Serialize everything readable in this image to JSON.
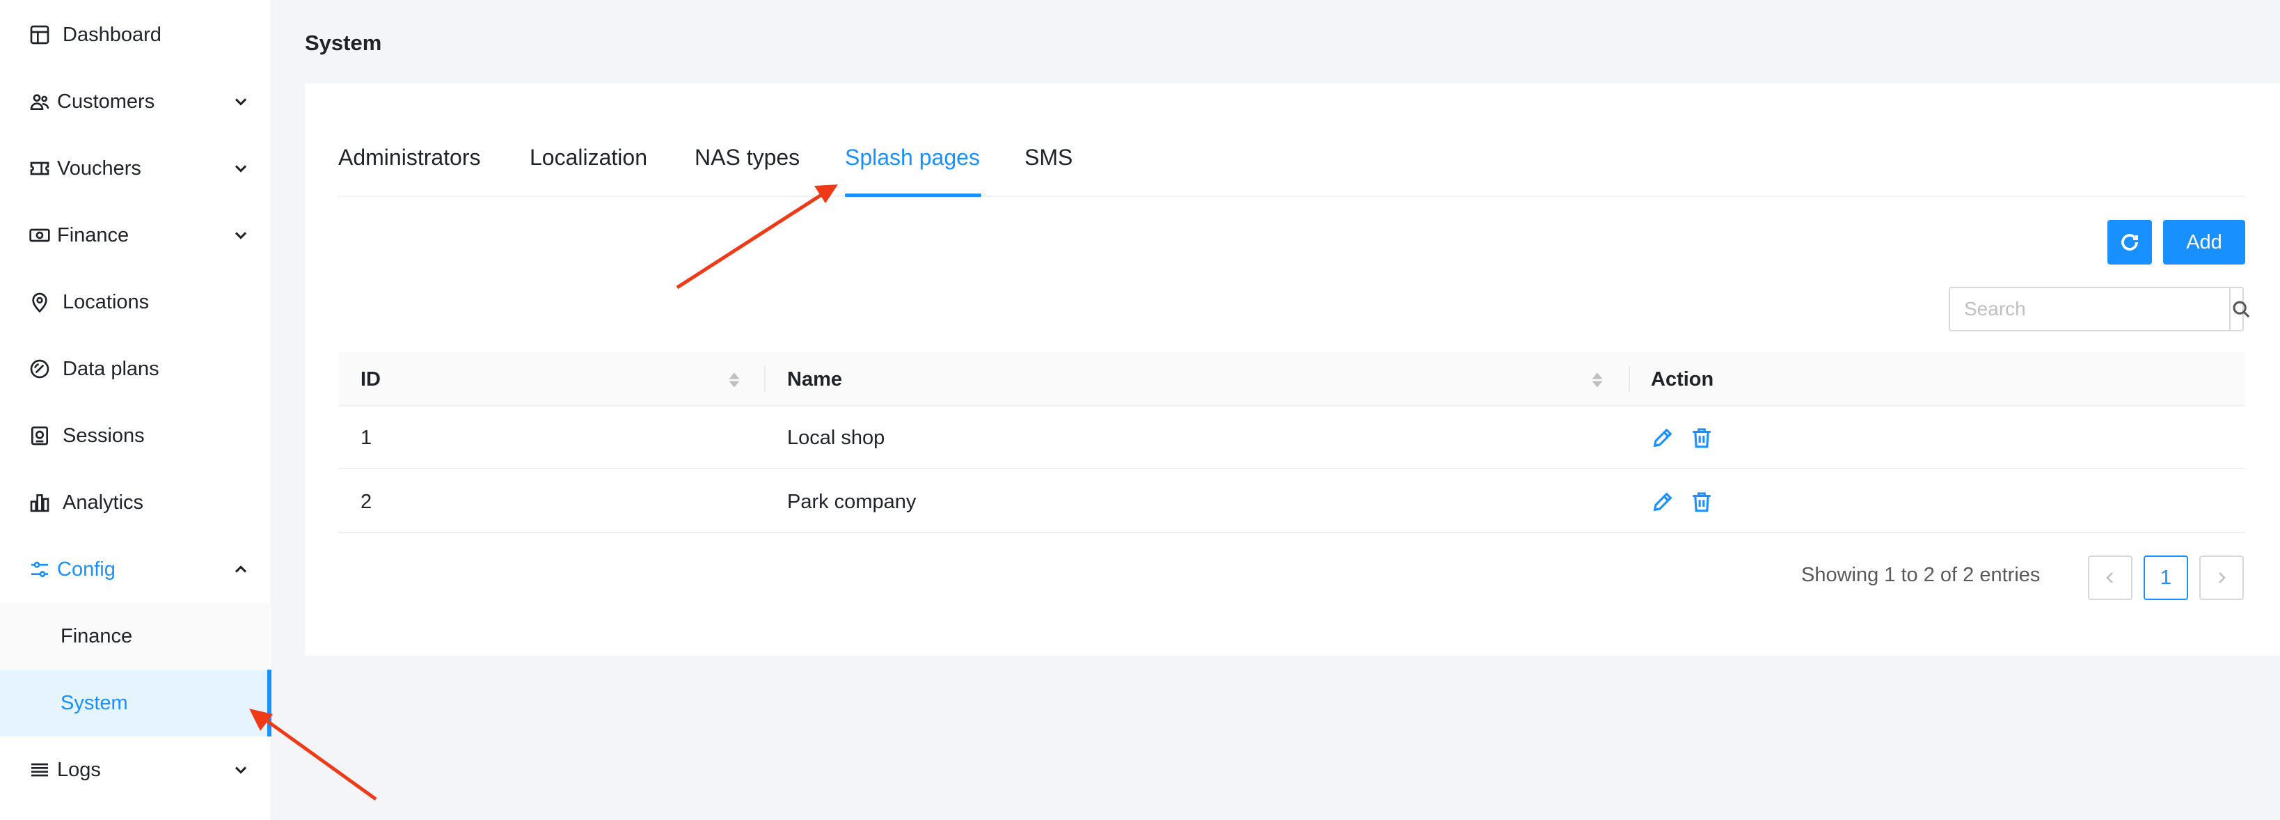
{
  "sidebar": {
    "items": [
      {
        "label": "Dashboard",
        "icon": "dashboard-icon"
      },
      {
        "label": "Customers",
        "icon": "users-icon"
      },
      {
        "label": "Vouchers",
        "icon": "ticket-icon"
      },
      {
        "label": "Finance",
        "icon": "money-icon"
      },
      {
        "label": "Locations",
        "icon": "location-pin-icon"
      },
      {
        "label": "Data plans",
        "icon": "data-plan-icon"
      },
      {
        "label": "Sessions",
        "icon": "sessions-icon"
      },
      {
        "label": "Analytics",
        "icon": "bar-chart-icon"
      },
      {
        "label": "Config",
        "icon": "sliders-icon"
      },
      {
        "label": "Logs",
        "icon": "list-icon"
      }
    ],
    "config_sub": [
      {
        "label": "Finance"
      },
      {
        "label": "System"
      }
    ]
  },
  "page": {
    "title": "System"
  },
  "tabs": [
    {
      "label": "Administrators"
    },
    {
      "label": "Localization"
    },
    {
      "label": "NAS types"
    },
    {
      "label": "Splash pages"
    },
    {
      "label": "SMS"
    }
  ],
  "active_tab": "Splash pages",
  "toolbar": {
    "add_label": "Add",
    "refresh_icon": "refresh-icon"
  },
  "search": {
    "placeholder": "Search",
    "value": ""
  },
  "table": {
    "columns": [
      "ID",
      "Name",
      "Action"
    ],
    "rows": [
      {
        "id": "1",
        "name": "Local shop"
      },
      {
        "id": "2",
        "name": "Park company"
      }
    ]
  },
  "pagination": {
    "info": "Showing 1 to 2 of 2 entries",
    "current_page": "1"
  },
  "colors": {
    "accent": "#1890ff",
    "annotation_arrow": "#f03a17"
  }
}
